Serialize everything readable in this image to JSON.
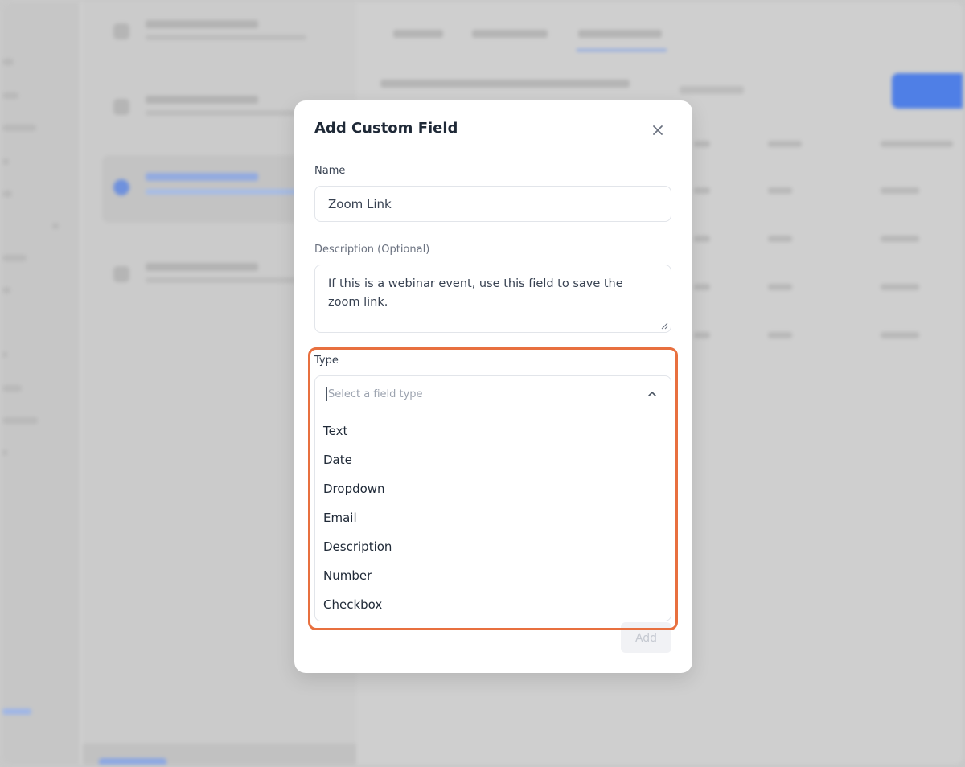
{
  "modal": {
    "title": "Add Custom Field",
    "close_icon": "close-icon",
    "name_field": {
      "label": "Name",
      "value": "Zoom Link"
    },
    "description_field": {
      "label": "Description (Optional)",
      "value": "If this is a webinar event, use this field to save the zoom link."
    },
    "type_field": {
      "label": "Type",
      "placeholder": "Select a field type",
      "options": [
        "Text",
        "Date",
        "Dropdown",
        "Email",
        "Description",
        "Number",
        "Checkbox"
      ]
    },
    "add_label": "Add"
  },
  "colors": {
    "highlight": "#e8703f",
    "accent_blue": "#4f7fe6"
  }
}
